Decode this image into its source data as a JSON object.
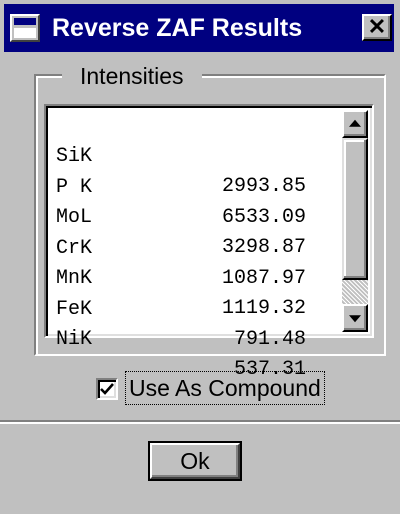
{
  "window": {
    "title": "Reverse ZAF Results",
    "close_symbol": "✕"
  },
  "group": {
    "label": "Intensities"
  },
  "intensities": [
    {
      "element": "SiK",
      "value": "2993.85"
    },
    {
      "element": "P K",
      "value": "6533.09"
    },
    {
      "element": "MoL",
      "value": "3298.87"
    },
    {
      "element": "CrK",
      "value": "1087.97"
    },
    {
      "element": "MnK",
      "value": "1119.32"
    },
    {
      "element": "FeK",
      "value": "791.48"
    },
    {
      "element": "NiK",
      "value": "537.31"
    }
  ],
  "compound_option": {
    "label": "Use As Compound",
    "checked": true
  },
  "buttons": {
    "ok_label": "Ok"
  },
  "icons": {
    "window_icon": "window-system-menu-icon",
    "close": "close-icon",
    "scroll_up": "arrow-up-icon",
    "scroll_down": "arrow-down-icon",
    "check": "checkmark-icon"
  },
  "colors": {
    "title_bar": "#000080",
    "face": "#c0c0c0"
  }
}
